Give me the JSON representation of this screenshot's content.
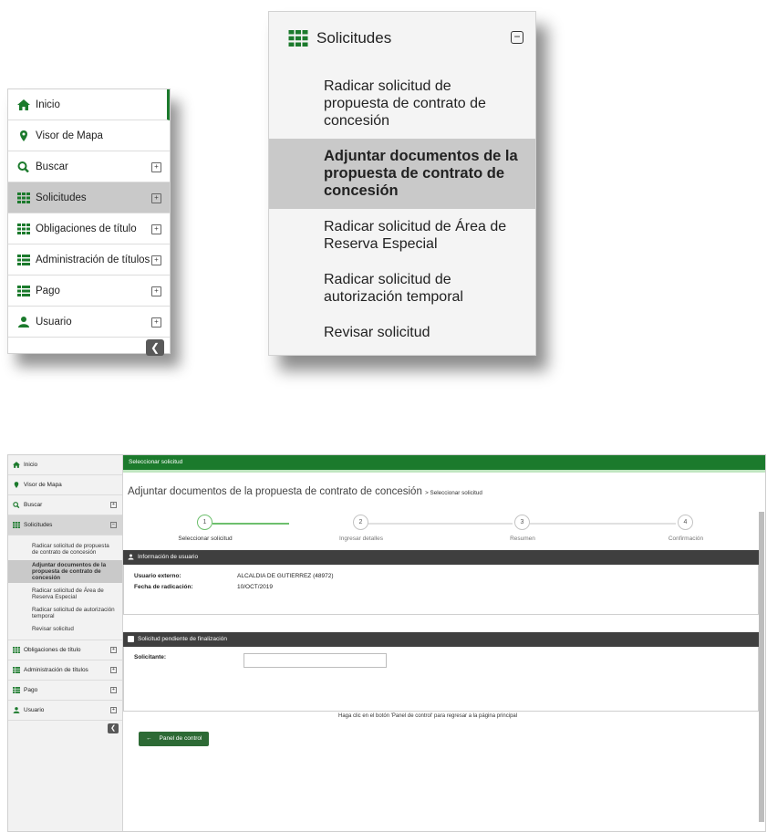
{
  "colors": {
    "brand_green": "#1b7a2c",
    "dark_panel": "#3f3f3f",
    "active_item": "#c9c9c9",
    "step_done": "#6dbf6d"
  },
  "menu": {
    "items": [
      {
        "label": "Inicio",
        "icon": "home-icon"
      },
      {
        "label": "Visor de Mapa",
        "icon": "map-marker-icon"
      },
      {
        "label": "Buscar",
        "icon": "search-icon"
      },
      {
        "label": "Solicitudes",
        "icon": "grid-icon"
      },
      {
        "label": "Obligaciones de título",
        "icon": "grid-icon"
      },
      {
        "label": "Administración de títulos",
        "icon": "list-icon"
      },
      {
        "label": "Pago",
        "icon": "list-icon"
      },
      {
        "label": "Usuario",
        "icon": "user-icon"
      }
    ],
    "submenu_title": "Solicitudes",
    "submenu": [
      "Radicar solicitud de propuesta de contrato de concesión",
      "Adjuntar documentos de la propuesta de contrato de concesión",
      "Radicar solicitud de Área de Reserva Especial",
      "Radicar solicitud de autorización temporal",
      "Revisar solicitud"
    ]
  },
  "screen": {
    "topbar": "Seleccionar solicitud",
    "page_title": "Adjuntar documentos de la propuesta de contrato de concesión",
    "page_subtitle": "> Seleccionar solicitud",
    "steps": [
      {
        "num": "1",
        "label": "Seleccionar solicitud"
      },
      {
        "num": "2",
        "label": "Ingresar detalles"
      },
      {
        "num": "3",
        "label": "Resumen"
      },
      {
        "num": "4",
        "label": "Confirmación"
      }
    ],
    "user_panel": {
      "title": "Información de usuario",
      "rows": [
        {
          "key": "Usuario externo:",
          "value": "ALCALDIA DE GUTIERREZ (48972)"
        },
        {
          "key": "Fecha de radicación:",
          "value": "10/OCT/2019"
        }
      ]
    },
    "pending_panel": {
      "title": "Solicitud pendiente de finalización",
      "field_label": "Solicitante:",
      "field_value": ""
    },
    "hint": "Haga clic en el botón 'Panel de control' para regresar a la página principal",
    "button": "Panel de control"
  }
}
